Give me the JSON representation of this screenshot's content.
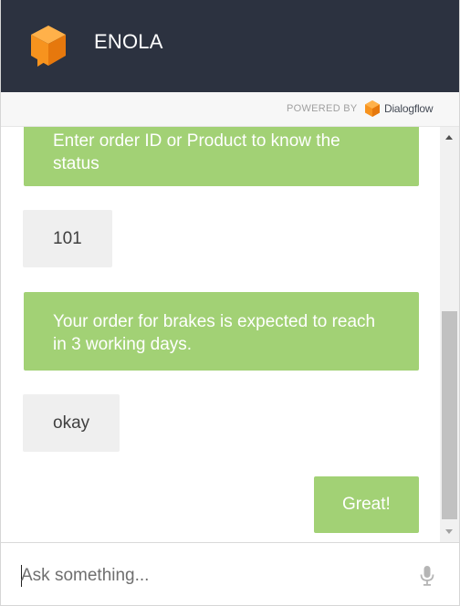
{
  "header": {
    "title": "ENOLA",
    "logo_icon": "orange-cube-speech-icon"
  },
  "powered_by": {
    "label": "POWERED BY",
    "brand": "Dialogflow"
  },
  "messages": [
    {
      "sender": "bot",
      "text": "Enter order ID or Product to know the status"
    },
    {
      "sender": "user",
      "text": "101"
    },
    {
      "sender": "bot",
      "text": "Your order for brakes is expected to reach in 3 working days."
    },
    {
      "sender": "user",
      "text": "okay"
    },
    {
      "sender": "bot",
      "text": "Great!"
    }
  ],
  "input": {
    "placeholder": "Ask something...",
    "value": "",
    "mic_icon": "microphone-icon"
  },
  "colors": {
    "header_bg": "#2c3240",
    "bot_bubble": "#a2d175",
    "user_bubble": "#efefef",
    "accent": "#f7931e"
  }
}
